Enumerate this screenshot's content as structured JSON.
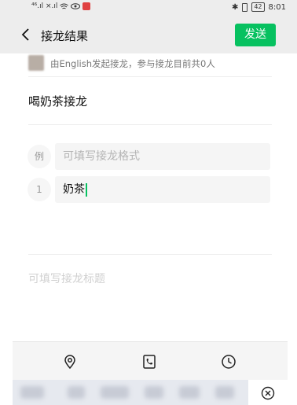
{
  "status_bar": {
    "signal_left": "⁴⁶.ıl  ×.ıl",
    "battery": "42",
    "time": "8:01"
  },
  "header": {
    "title": "接龙结果",
    "send_label": "发送"
  },
  "info": {
    "text": "由English发起接龙，参与接龙目前共0人"
  },
  "topic": "喝奶茶接龙",
  "rows": [
    {
      "num": "例",
      "placeholder": "可填写接龙格式",
      "value": ""
    },
    {
      "num": "1",
      "placeholder": "",
      "value": "奶茶"
    }
  ],
  "title_placeholder": "可填写接龙标题",
  "toolbar": {
    "icons": [
      "location-icon",
      "phone-icon",
      "clock-icon"
    ]
  },
  "colors": {
    "accent": "#07c160",
    "header_bg": "#ededed"
  }
}
